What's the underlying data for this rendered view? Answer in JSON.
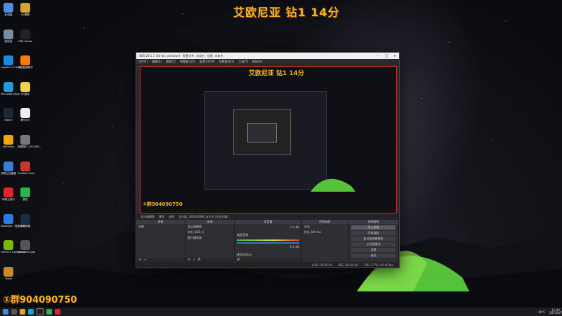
{
  "overlay": {
    "title": "艾欧尼亚 钻1 14分",
    "group": "①群904090750"
  },
  "desktop_icons": [
    {
      "label": "此电脑",
      "icon": "pc-icon",
      "color": "#4a90e2"
    },
    {
      "label": "VV看看",
      "icon": "owl-icon",
      "color": "#d9a132"
    },
    {
      "label": "回收站",
      "icon": "recycle-bin-icon",
      "color": "#7a8ca0"
    },
    {
      "label": "OBS Studio",
      "icon": "obs-icon",
      "color": "#222"
    },
    {
      "label": "Logitech G HUB",
      "icon": "ghub-icon",
      "color": "#1e88e5"
    },
    {
      "label": "火狐直播助手",
      "icon": "fox-icon",
      "color": "#ff7a00"
    },
    {
      "label": "Microsoft Edge",
      "icon": "edge-icon",
      "color": "#1e9fd6"
    },
    {
      "label": "QQ音乐",
      "icon": "qqmusic-icon",
      "color": "#f5d04a"
    },
    {
      "label": "Steam",
      "icon": "steam-icon",
      "color": "#1b2838"
    },
    {
      "label": "腾讯QQ",
      "icon": "qq-icon",
      "color": "#eeeeee"
    },
    {
      "label": "WeGame",
      "icon": "wegame-icon",
      "color": "#f0a500"
    },
    {
      "label": "新建图片 2022061...",
      "icon": "image-icon",
      "color": "#777"
    },
    {
      "label": "网易云加速器",
      "icon": "uu-icon",
      "color": "#3a7bd5"
    },
    {
      "label": "Football Party",
      "icon": "game-icon",
      "color": "#c0392b"
    },
    {
      "label": "网易云音乐",
      "icon": "netease-music-icon",
      "color": "#e0262c"
    },
    {
      "label": "微信",
      "icon": "wechat-icon",
      "color": "#2db34a"
    },
    {
      "label": "BandiZip - 快捷方式",
      "icon": "bandizip-icon",
      "color": "#2a7be4"
    },
    {
      "label": "英雄联盟",
      "icon": "lol-icon",
      "color": "#1a2b44"
    },
    {
      "label": "GeForce Experience",
      "icon": "nvidia-icon",
      "color": "#76b900"
    },
    {
      "label": "Dread Hunger",
      "icon": "dread-hunger-icon",
      "color": "#555"
    },
    {
      "label": "Trade",
      "icon": "trade-icon",
      "color": "#c98a2b"
    }
  ],
  "obs": {
    "window_title": "OBS 29.1.3 (64-bit, windows) - 配置文件: 未命名 - 场景: 未命名",
    "menu": [
      "文件(F)",
      "编辑(E)",
      "视图(V)",
      "停靠窗口(D)",
      "配置文件(P)",
      "场景集合(S)",
      "工具(T)",
      "帮助(H)"
    ],
    "preview": {
      "title": "艾欧尼亚 钻1 14分",
      "group": "①群904090750"
    },
    "source_bar": {
      "label": "显示器捕获",
      "buttons": [
        "属性",
        "滤镜"
      ],
      "monitor": "显示器: 1920x1080 @ 0,0 (主显示器)"
    },
    "docks": {
      "scenes": {
        "header": "场景",
        "items": [
          "场景"
        ]
      },
      "sources": {
        "header": "来源",
        "items": [
          "显示器捕获",
          "文本 (GDI+)",
          "图片捕获源"
        ]
      },
      "mixer": {
        "header": "混音器",
        "channels": [
          {
            "name": "桌面音频",
            "level": "-1.4 dB"
          },
          {
            "name": "麦克风/Aux",
            "level": "0.0 dB"
          }
        ]
      },
      "transitions": {
        "header": "转场动画",
        "type": "淡出",
        "duration_label": "时长",
        "duration": "300 ms"
      },
      "controls": {
        "header": "控制按钮",
        "buttons": [
          "停止直播",
          "开始录制",
          "启动虚拟摄像机",
          "工作室模式",
          "设置",
          "退出"
        ]
      }
    },
    "status": {
      "live": "LIVE: 00:00:26",
      "rec": "REC: 00:00:00",
      "cpu": "CPU: 2.7%, 60.00 fps"
    }
  },
  "taskbar": {
    "temperature": "26°C",
    "time": "11:20",
    "date": "2023/8/7"
  }
}
